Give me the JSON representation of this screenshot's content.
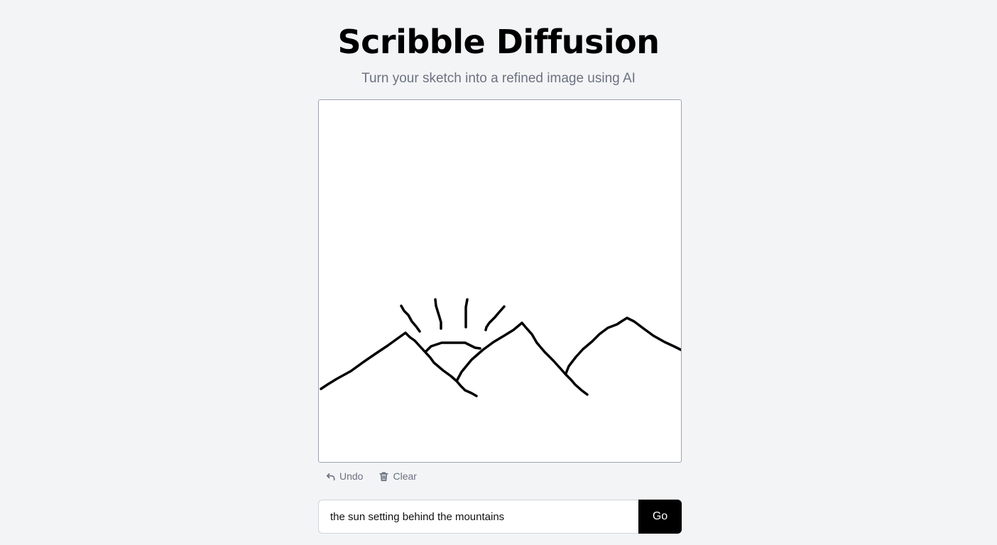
{
  "header": {
    "title": "Scribble Diffusion",
    "subtitle": "Turn your sketch into a refined image using AI"
  },
  "canvas": {
    "stroke_color": "#000000",
    "background": "#ffffff"
  },
  "toolbar": {
    "undo_label": "Undo",
    "undo_icon": "undo-arrow-icon",
    "clear_label": "Clear",
    "clear_icon": "trash-icon"
  },
  "prompt": {
    "value": "the sun setting behind the mountains",
    "button_label": "Go"
  }
}
